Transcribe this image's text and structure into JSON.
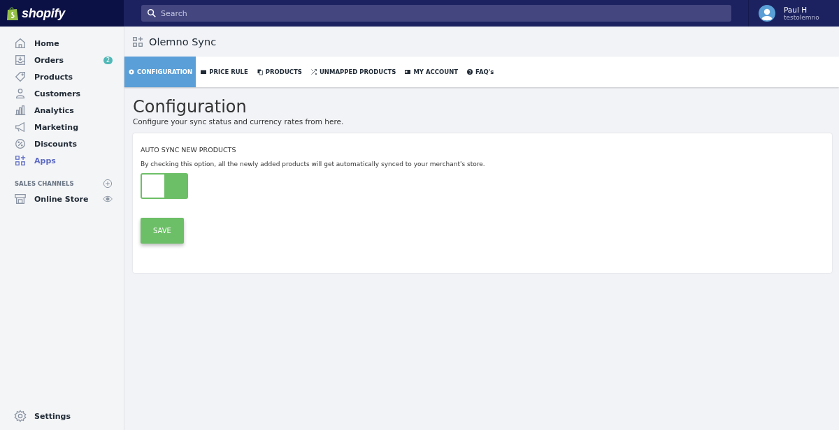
{
  "topbar": {
    "logo": "shopify",
    "search": {
      "placeholder": "Search"
    },
    "user": {
      "name": "Paul H",
      "store": "testolemno"
    }
  },
  "sidebar": {
    "items": [
      {
        "label": "Home",
        "selected": false
      },
      {
        "label": "Orders",
        "selected": false,
        "badge": "2"
      },
      {
        "label": "Products",
        "selected": false
      },
      {
        "label": "Customers",
        "selected": false
      },
      {
        "label": "Analytics",
        "selected": false
      },
      {
        "label": "Marketing",
        "selected": false
      },
      {
        "label": "Discounts",
        "selected": false
      },
      {
        "label": "Apps",
        "selected": true
      }
    ],
    "section": {
      "title": "SALES CHANNELS",
      "items": [
        {
          "label": "Online Store"
        }
      ]
    },
    "settings": "Settings"
  },
  "app": {
    "title": "Olemno Sync",
    "tabs": [
      {
        "label": "CONFIGURATION",
        "selected": true
      },
      {
        "label": "PRICE RULE",
        "selected": false
      },
      {
        "label": "PRODUCTS",
        "selected": false
      },
      {
        "label": "UNMAPPED PRODUCTS",
        "selected": false
      },
      {
        "label": "MY ACCOUNT",
        "selected": false
      },
      {
        "label": "FAQ's",
        "selected": false
      }
    ],
    "heading": "Configuration",
    "subheading": "Configure your sync status and currency rates from here.",
    "card": {
      "title": "AUTO SYNC NEW PRODUCTS",
      "description": "By checking this option, all the newly added products will get automatically synced to your merchant's store.",
      "toggle": {
        "on": true
      },
      "button": "SAVE"
    }
  }
}
